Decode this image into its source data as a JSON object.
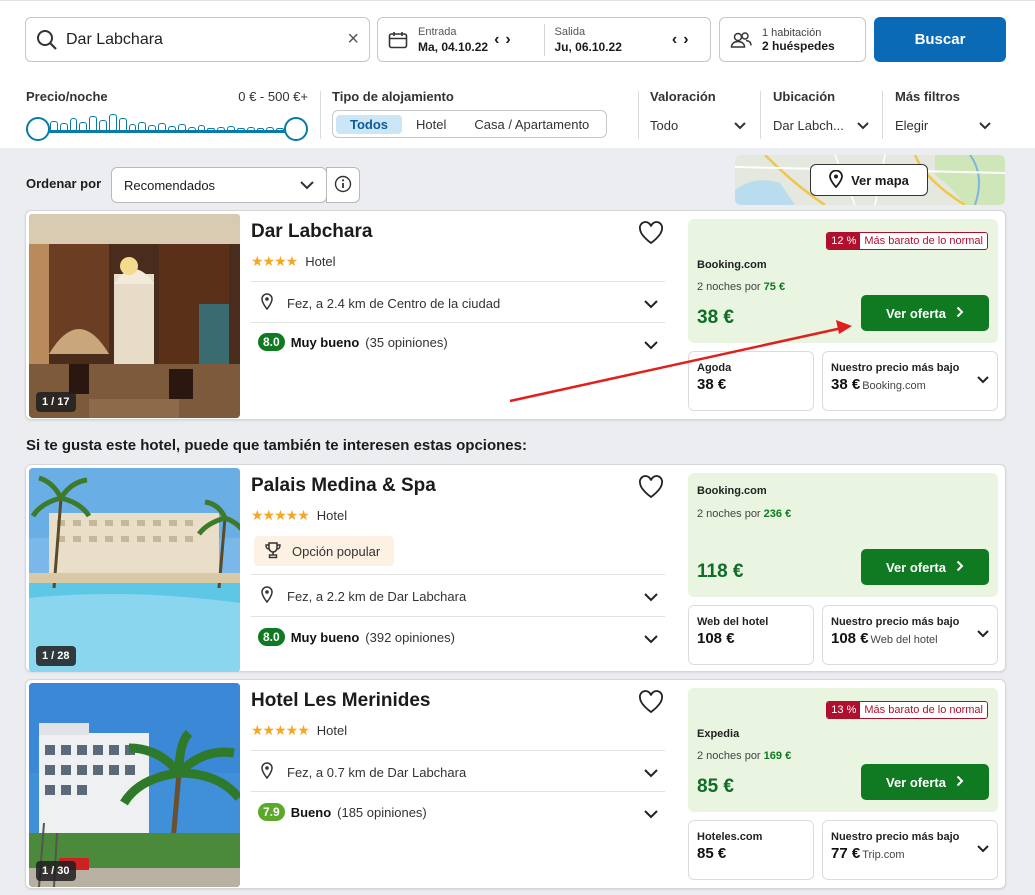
{
  "search": {
    "destination": "Dar Labchara"
  },
  "dates": {
    "checkin_label": "Entrada",
    "checkin_value": "Ma, 04.10.22",
    "checkout_label": "Salida",
    "checkout_value": "Ju, 06.10.22"
  },
  "guests": {
    "rooms": "1 habitación",
    "people": "2 huéspedes"
  },
  "search_button": "Buscar",
  "filters": {
    "price_label": "Precio/noche",
    "price_range": "0 € - 500 €+",
    "type_label": "Tipo de alojamiento",
    "type_options": [
      "Todos",
      "Hotel",
      "Casa / Apartamento"
    ],
    "rating_label": "Valoración",
    "rating_value": "Todo",
    "location_label": "Ubicación",
    "location_value": "Dar Labch...",
    "more_label": "Más filtros",
    "more_value": "Elegir"
  },
  "sort": {
    "label": "Ordenar por",
    "value": "Recomendados"
  },
  "map": {
    "button": "Ver mapa"
  },
  "section_title": "Si te gusta este hotel, puede que también te interesen estas opciones:",
  "hotels": [
    {
      "name": "Dar Labchara",
      "type": "Hotel",
      "stars": "★★★★",
      "photo_count": "1 / 17",
      "location": "Fez, a 2.4 km de Centro de la ciudad",
      "score": "8.0",
      "score_label": "Muy bueno",
      "reviews": "(35 opiniones)",
      "deal": {
        "badge_pct": "12 %",
        "badge_text": "Más barato de lo normal",
        "provider": "Booking.com",
        "nights_prefix": "2 noches por",
        "nights_price": "75 €",
        "price": "38 €",
        "cta": "Ver oferta"
      },
      "alt1": {
        "provider": "Agoda",
        "price": "38 €"
      },
      "alt2": {
        "label": "Nuestro precio más bajo",
        "price": "38 €",
        "provider": "Booking.com"
      }
    },
    {
      "name": "Palais Medina & Spa",
      "type": "Hotel",
      "stars": "★★★★★",
      "photo_count": "1 / 28",
      "popular": "Opción popular",
      "location": "Fez, a 2.2 km de Dar Labchara",
      "score": "8.0",
      "score_label": "Muy bueno",
      "reviews": "(392 opiniones)",
      "deal": {
        "provider": "Booking.com",
        "nights_prefix": "2 noches por",
        "nights_price": "236 €",
        "price": "118 €",
        "cta": "Ver oferta"
      },
      "alt1": {
        "provider": "Web del hotel",
        "price": "108 €"
      },
      "alt2": {
        "label": "Nuestro precio más bajo",
        "price": "108 €",
        "provider": "Web del hotel"
      }
    },
    {
      "name": "Hotel Les Merinides",
      "type": "Hotel",
      "stars": "★★★★★",
      "photo_count": "1 / 30",
      "location": "Fez, a 0.7 km de Dar Labchara",
      "score": "7.9",
      "score_label": "Bueno",
      "reviews": "(185 opiniones)",
      "deal": {
        "badge_pct": "13 %",
        "badge_text": "Más barato de lo normal",
        "provider": "Expedia",
        "nights_prefix": "2 noches por",
        "nights_price": "169 €",
        "price": "85 €",
        "cta": "Ver oferta"
      },
      "alt1": {
        "provider": "Hoteles.com",
        "price": "85 €"
      },
      "alt2": {
        "label": "Nuestro precio más bajo",
        "price": "77 €",
        "provider": "Trip.com"
      }
    }
  ],
  "colors": {
    "primary": "#0a6ab6",
    "deal_green": "#0f7a21",
    "badge_red": "#b0102e",
    "annotation_arrow": "#e0201c"
  }
}
